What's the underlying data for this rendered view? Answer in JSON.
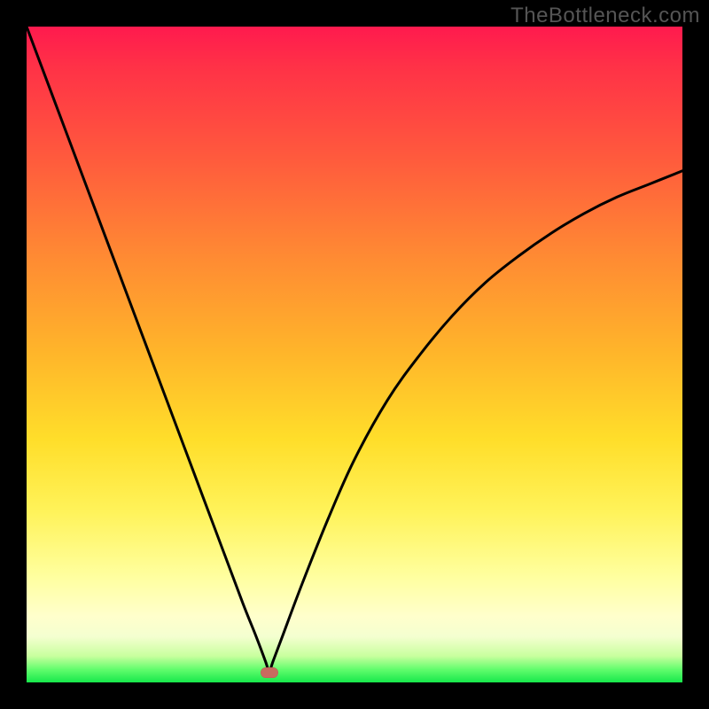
{
  "watermark": "TheBottleneck.com",
  "colors": {
    "curve_stroke": "#000000",
    "marker_fill": "#c96a5f",
    "frame_bg": "#000000"
  },
  "chart_data": {
    "type": "line",
    "title": "",
    "xlabel": "",
    "ylabel": "",
    "xlim": [
      0,
      100
    ],
    "ylim": [
      0,
      100
    ],
    "grid": false,
    "legend": false,
    "annotations": [
      {
        "name": "minimum-marker",
        "x": 37,
        "y": 1.5
      }
    ],
    "series": [
      {
        "name": "bottleneck-curve",
        "x": [
          0,
          3,
          6,
          9,
          12,
          15,
          18,
          21,
          24,
          27,
          30,
          33,
          35,
          36.5,
          37,
          37.5,
          39,
          42,
          46,
          50,
          55,
          60,
          65,
          70,
          75,
          80,
          85,
          90,
          95,
          100
        ],
        "y": [
          100,
          92,
          84,
          76,
          68,
          60,
          52,
          44,
          36,
          28,
          20,
          12,
          7,
          3,
          1.5,
          3,
          7,
          15,
          25,
          34,
          43,
          50,
          56,
          61,
          65,
          68.5,
          71.5,
          74,
          76,
          78
        ]
      }
    ]
  }
}
